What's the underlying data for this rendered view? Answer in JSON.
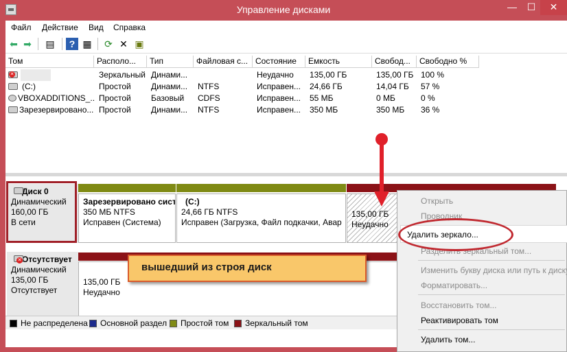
{
  "window": {
    "title": "Управление дисками",
    "min": "—",
    "max": "☐",
    "close": "✕"
  },
  "menu": [
    "Файл",
    "Действие",
    "Вид",
    "Справка"
  ],
  "columns": [
    "Том",
    "Располо...",
    "Тип",
    "Файловая с...",
    "Состояние",
    "Емкость",
    "Свобод...",
    "Свободно %"
  ],
  "volumes": [
    {
      "name": "",
      "layout": "Зеркальный",
      "type": "Динами...",
      "fs": "",
      "status": "Неудачно",
      "capacity": "135,00 ГБ",
      "free": "135,00 ГБ",
      "free_pct": "100 %"
    },
    {
      "name": "(C:)",
      "layout": "Простой",
      "type": "Динами...",
      "fs": "NTFS",
      "status": "Исправен...",
      "capacity": "24,66 ГБ",
      "free": "14,04 ГБ",
      "free_pct": "57 %"
    },
    {
      "name": "VBOXADDITIONS_...",
      "layout": "Простой",
      "type": "Базовый",
      "fs": "CDFS",
      "status": "Исправен...",
      "capacity": "55 МБ",
      "free": "0 МБ",
      "free_pct": "0 %"
    },
    {
      "name": "Зарезервировано...",
      "layout": "Простой",
      "type": "Динами...",
      "fs": "NTFS",
      "status": "Исправен...",
      "capacity": "350 МБ",
      "free": "350 МБ",
      "free_pct": "36 %"
    }
  ],
  "disk0": {
    "name": "Диск 0",
    "type": "Динамический",
    "size": "160,00 ГБ",
    "state": "В сети",
    "parts": [
      {
        "title": "Зарезервировано сист",
        "line1": "350 МБ NTFS",
        "line2": "Исправен (Система)"
      },
      {
        "title": "(C:)",
        "line1": "24,66 ГБ NTFS",
        "line2": "Исправен (Загрузка, Файл подкачки, Авар"
      },
      {
        "title": "",
        "line1": "135,00 ГБ",
        "line2": "Неудачно"
      }
    ]
  },
  "missing": {
    "name": "Отсутствует",
    "type": "Динамический",
    "size": "135,00 ГБ",
    "state": "Отсутствует",
    "part": {
      "line1": "135,00 ГБ",
      "line2": "Неудачно"
    }
  },
  "legend": [
    "Не распределена",
    "Основной раздел",
    "Простой том",
    "Зеркальный том"
  ],
  "context_menu": {
    "items": [
      "Открыть",
      "Проводник",
      "Удалить зеркало...",
      "Разделить зеркальный том...",
      "Изменить букву диска или путь к диску...",
      "Форматировать...",
      "Восстановить том...",
      "Реактивировать том",
      "Удалить том..."
    ]
  },
  "annotation": "вышедший из строя диск",
  "colors": {
    "unallocated": "#000000",
    "primary": "#1c2a8c",
    "simple": "#7f8a14",
    "mirror": "#8b1217",
    "frame": "#c54e57"
  }
}
